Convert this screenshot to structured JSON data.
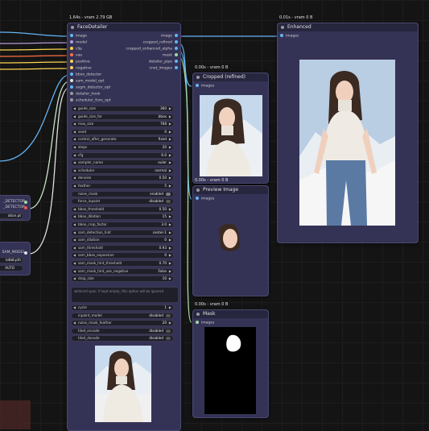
{
  "canvas": {
    "bg": "#141414"
  },
  "left_nodes": {
    "detector_a": "_DETECTOR",
    "detector_b": "_DETECTOR",
    "model_file": "ation.pt",
    "sam_model": "SAM_MODEL",
    "sam_file": "b4b8.pth",
    "auto_label": "AUTO"
  },
  "face_detailer": {
    "timing": "1.64s - vram 2.79 GB",
    "title": "FaceDetailer",
    "inputs": [
      "image",
      "model",
      "clip",
      "vae",
      "positive",
      "negative",
      "bbox_detector",
      "sam_model_opt",
      "segm_detector_opt",
      "detailer_hook",
      "scheduler_func_opt"
    ],
    "outputs": [
      "image",
      "cropped_refined",
      "cropped_enhanced_alpha",
      "mask",
      "detailer_pipe",
      "cnet_images"
    ],
    "widgets": [
      {
        "label": "guide_size",
        "value": "360"
      },
      {
        "label": "guide_size_for",
        "value": "bbox"
      },
      {
        "label": "max_size",
        "value": "768"
      },
      {
        "label": "seed",
        "value": "0"
      },
      {
        "label": "control_after_generate",
        "value": "fixed"
      },
      {
        "label": "steps",
        "value": "20"
      },
      {
        "label": "cfg",
        "value": "6.0"
      },
      {
        "label": "sampler_name",
        "value": "euler"
      },
      {
        "label": "scheduler",
        "value": "normal"
      },
      {
        "label": "denoise",
        "value": "0.50"
      },
      {
        "label": "feather",
        "value": "5"
      },
      {
        "label": "noise_mask",
        "value": "enabled"
      },
      {
        "label": "force_inpaint",
        "value": "disabled"
      },
      {
        "label": "bbox_threshold",
        "value": "0.50"
      },
      {
        "label": "bbox_dilation",
        "value": "15"
      },
      {
        "label": "bbox_crop_factor",
        "value": "3.0"
      },
      {
        "label": "sam_detection_hint",
        "value": "center-1"
      },
      {
        "label": "sam_dilation",
        "value": "0"
      },
      {
        "label": "sam_threshold",
        "value": "0.93"
      },
      {
        "label": "sam_bbox_expansion",
        "value": "0"
      },
      {
        "label": "sam_mask_hint_threshold",
        "value": "0.70"
      },
      {
        "label": "sam_mask_hint_use_negative",
        "value": "False"
      },
      {
        "label": "drop_size",
        "value": "10"
      }
    ],
    "wildcard_placeholder": "wildcard spec: if kept empty, this option will be ignored",
    "widgets2": [
      {
        "label": "cycle",
        "value": "1"
      },
      {
        "label": "inpaint_model",
        "value": "disabled"
      },
      {
        "label": "noise_mask_feather",
        "value": "20"
      },
      {
        "label": "tiled_encode",
        "value": "disabled"
      },
      {
        "label": "tiled_decode",
        "value": "disabled"
      }
    ]
  },
  "enhanced": {
    "timing": "0.01s - vram 0 B",
    "title": "Enhanced",
    "input": "images"
  },
  "cropped": {
    "timing": "0.00s - vram 0 B",
    "title": "Cropped (refined)",
    "input": "images"
  },
  "preview": {
    "timing": "0.00s - vram 0 B",
    "title": "Preview Image",
    "input": "images"
  },
  "mask": {
    "timing": "0.00s - vram 0 B",
    "title": "Mask",
    "input": "images"
  },
  "colors": {
    "wire_image": "#64b5f6",
    "wire_clip": "#ffd54f",
    "wire_vae": "#ff7043",
    "wire_model": "#b39ddb",
    "wire_pos": "#a5d6a7",
    "wire_neg": "#ef9a9a",
    "wire_misc": "#e0e0e0"
  }
}
